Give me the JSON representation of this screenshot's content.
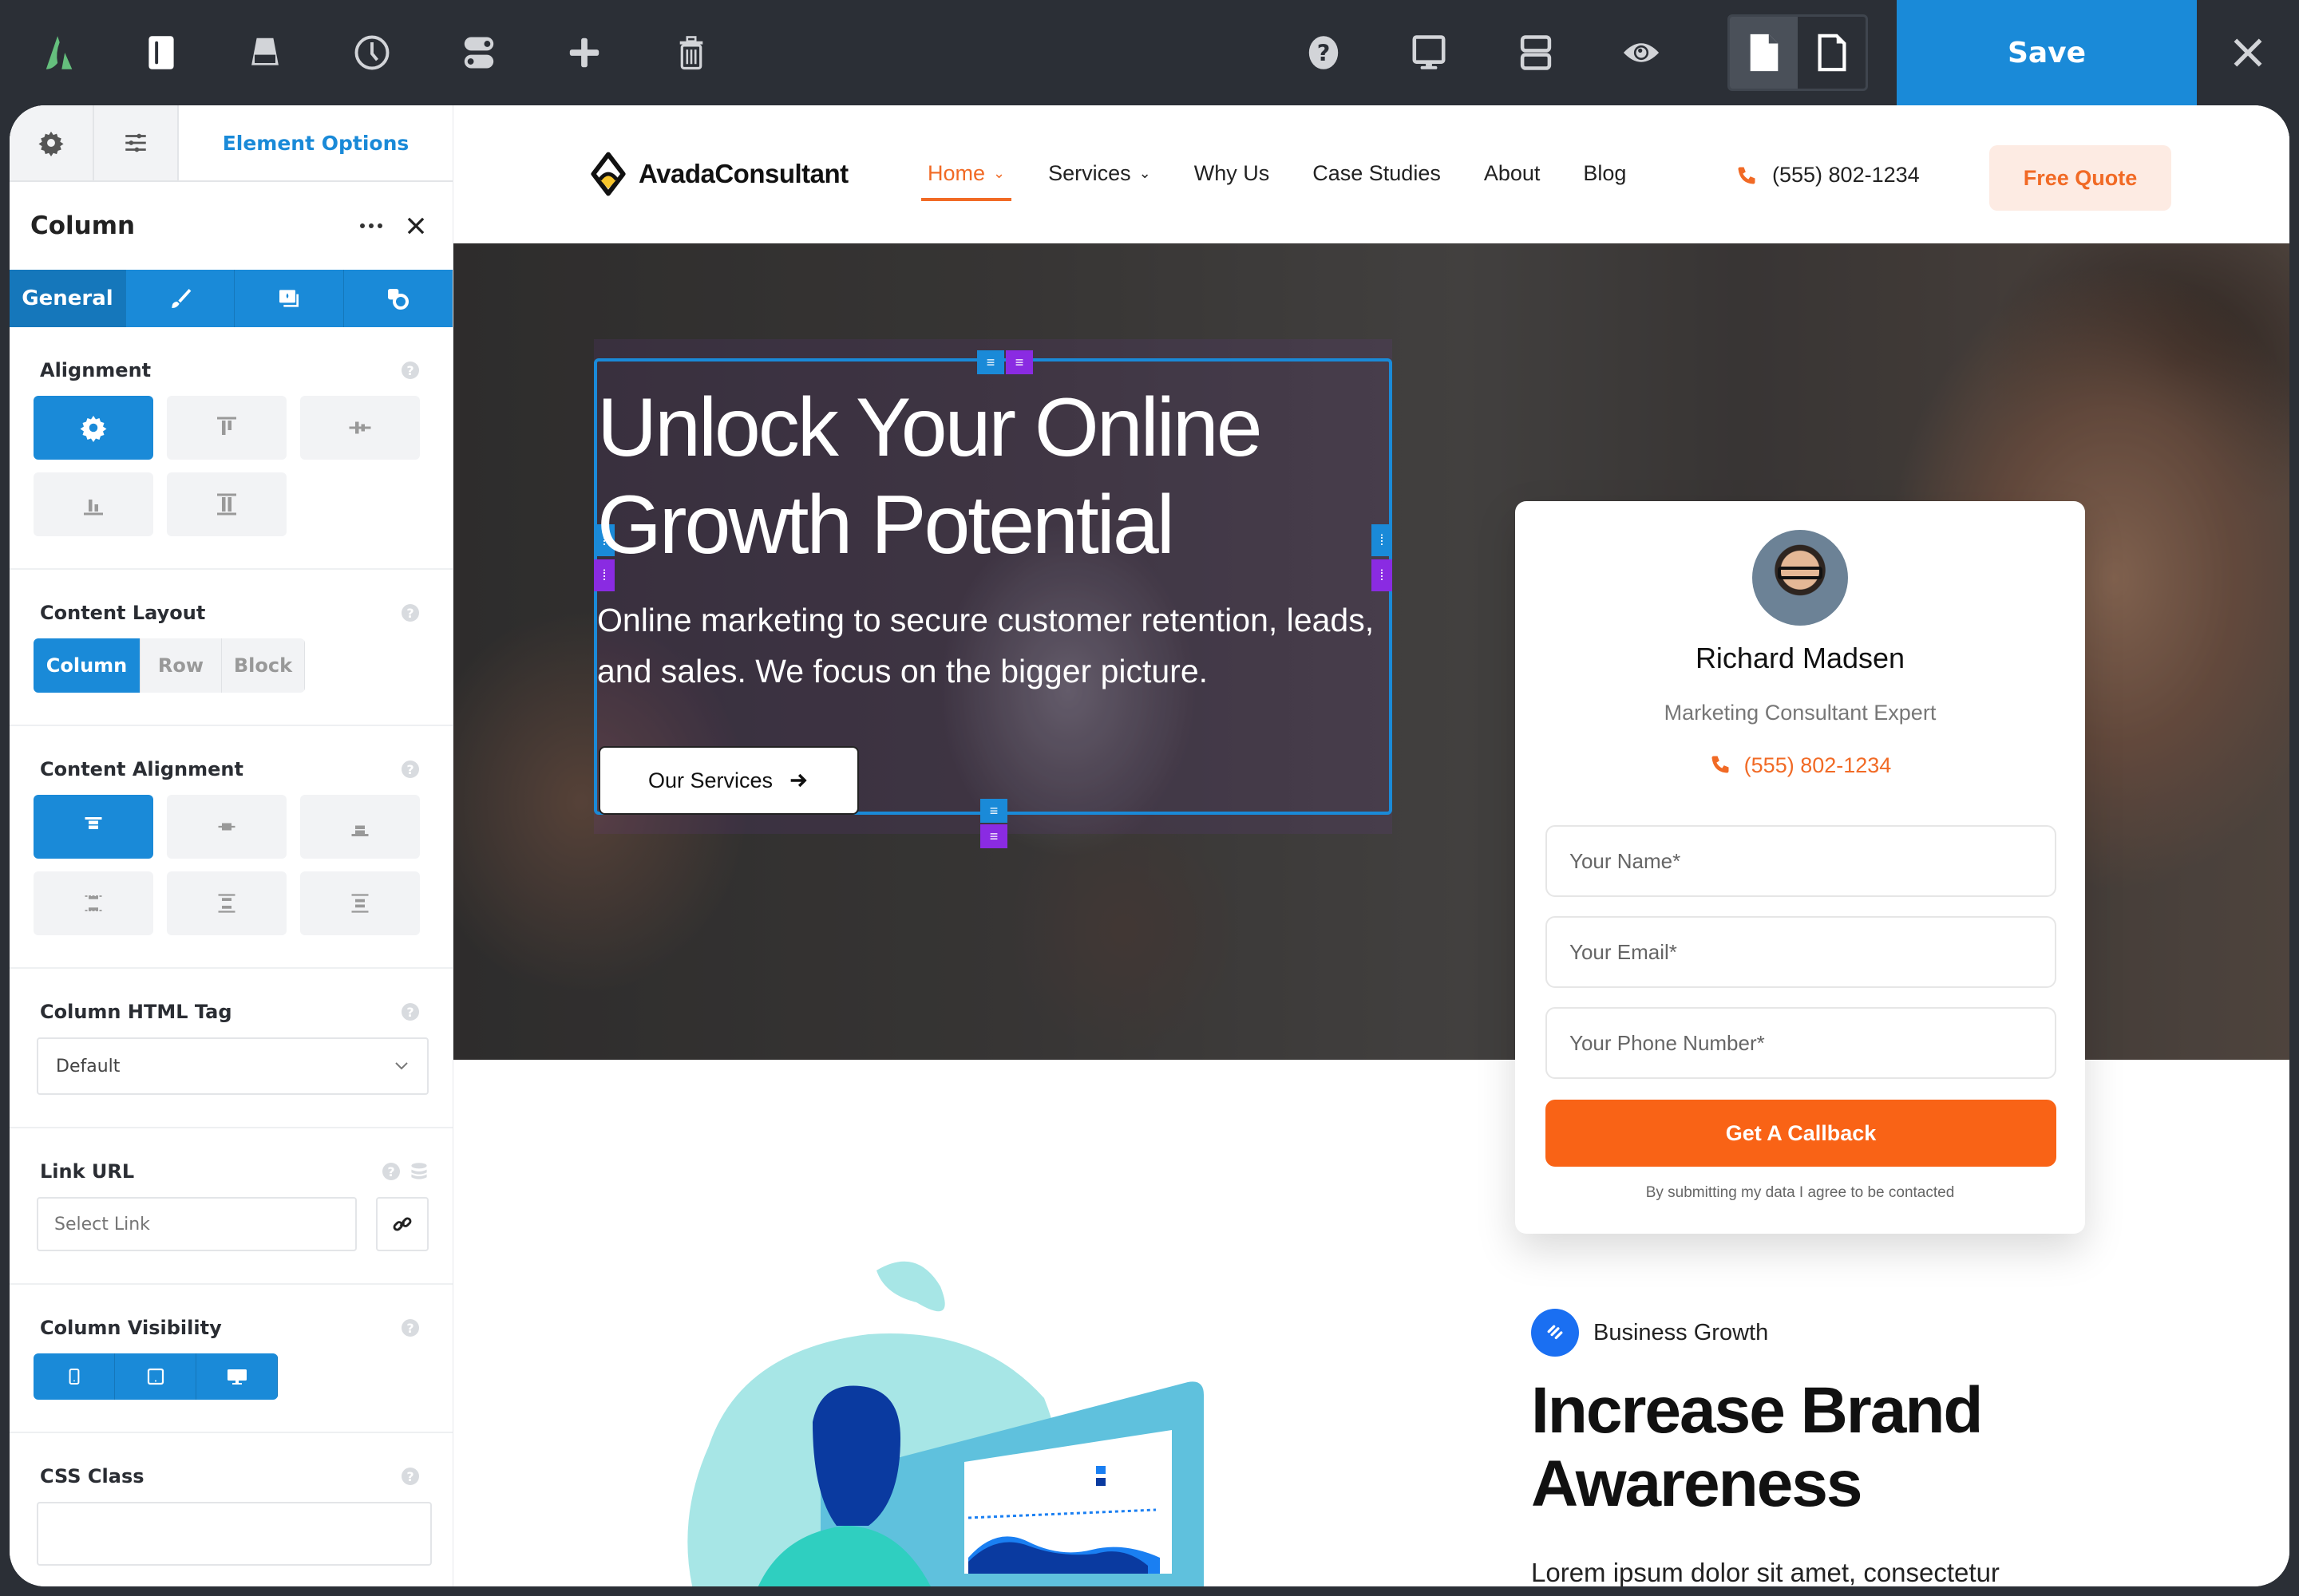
{
  "toolbar": {
    "logo": "avada-logo",
    "icons": [
      "sidebar-toggle",
      "library",
      "history",
      "toggles",
      "add",
      "delete"
    ],
    "right_icons": [
      "help",
      "desktop-preview",
      "layout-sections",
      "preview-eye"
    ],
    "page_toggle": [
      "page-filled",
      "page-outline"
    ],
    "save_label": "Save",
    "close": "close"
  },
  "panel": {
    "top_tabs": [
      "settings",
      "sliders"
    ],
    "active_tab_label": "Element Options",
    "title": "Column",
    "option_tabs": {
      "active_label": "General",
      "icons": [
        "design-brush",
        "background",
        "extras"
      ]
    },
    "sections": {
      "alignment": {
        "label": "Alignment",
        "options": [
          "auto",
          "top",
          "center",
          "bottom",
          "stretch"
        ],
        "selected": "auto"
      },
      "content_layout": {
        "label": "Content Layout",
        "options": [
          "Column",
          "Row",
          "Block"
        ],
        "selected": "Column"
      },
      "content_alignment": {
        "label": "Content Alignment",
        "options": [
          "flex-start",
          "center",
          "flex-end",
          "space-between",
          "space-around",
          "space-evenly"
        ],
        "selected": "flex-start"
      },
      "html_tag": {
        "label": "Column HTML Tag",
        "value": "Default"
      },
      "link_url": {
        "label": "Link URL",
        "placeholder": "Select Link"
      },
      "visibility": {
        "label": "Column Visibility",
        "options": [
          "small-screen",
          "medium-screen",
          "large-screen"
        ]
      },
      "css_class": {
        "label": "CSS Class",
        "value": ""
      }
    }
  },
  "site": {
    "brand": "AvadaConsultant",
    "nav": [
      {
        "label": "Home",
        "dropdown": true,
        "active": true
      },
      {
        "label": "Services",
        "dropdown": true,
        "active": false
      },
      {
        "label": "Why Us",
        "dropdown": false,
        "active": false
      },
      {
        "label": "Case Studies",
        "dropdown": false,
        "active": false
      },
      {
        "label": "About",
        "dropdown": false,
        "active": false
      },
      {
        "label": "Blog",
        "dropdown": false,
        "active": false
      }
    ],
    "phone": "(555) 802-1234",
    "cta": "Free Quote",
    "hero": {
      "title": "Unlock Your Online Growth Potential",
      "subtitle": "Online marketing to secure customer retention, leads, and sales. We focus on the bigger picture.",
      "button": "Our Services"
    },
    "card": {
      "name": "Richard Madsen",
      "role": "Marketing Consultant Expert",
      "phone": "(555) 802-1234",
      "fields": [
        "Your Name*",
        "Your Email*",
        "Your Phone Number*"
      ],
      "submit": "Get A Callback",
      "consent": "By submitting my data I agree to be contacted"
    },
    "feature": {
      "badge": "Business Growth",
      "title": "Increase Brand Awareness",
      "body": "Lorem ipsum dolor sit amet, consectetur"
    }
  },
  "colors": {
    "accent_blue": "#1a8ad8",
    "brand_orange": "#f16a25",
    "button_orange": "#f96316",
    "toolbar_bg": "#2b2f36",
    "handle_purple": "#8a2be2"
  }
}
